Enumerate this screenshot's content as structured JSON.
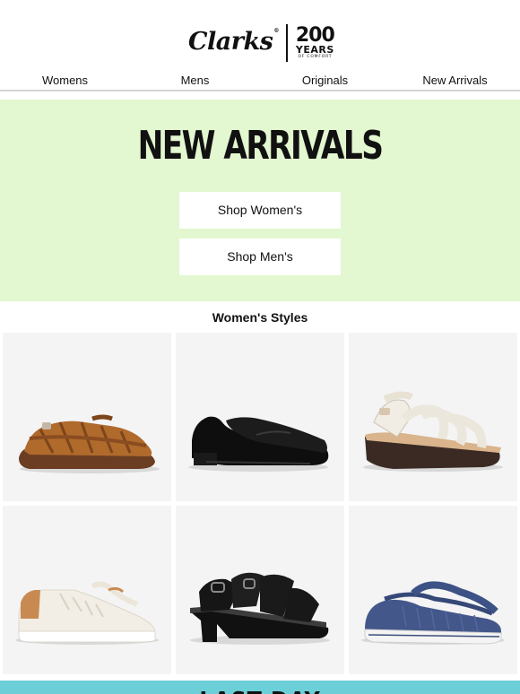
{
  "brand": {
    "wordmark": "Clarks",
    "reg_mark": "®",
    "anniversary_number": "200",
    "anniversary_word": "YEARS",
    "anniversary_tagline": "OF COMFORT"
  },
  "nav": {
    "items": [
      {
        "label": "Womens"
      },
      {
        "label": "Mens"
      },
      {
        "label": "Originals"
      },
      {
        "label": "New Arrivals"
      }
    ]
  },
  "hero": {
    "title": "NEW ARRIVALS",
    "background": "#e3f7d0",
    "buttons": {
      "women": "Shop Women's",
      "men": "Shop Men's"
    }
  },
  "section": {
    "title": "Women's Styles"
  },
  "products": [
    {
      "icon": "tan-fisherman-sandal-image"
    },
    {
      "icon": "black-leather-loafer-image"
    },
    {
      "icon": "white-strappy-wedge-sandal-image"
    },
    {
      "icon": "white-knit-sneaker-image"
    },
    {
      "icon": "black-buckle-heeled-sandal-image"
    },
    {
      "icon": "navy-knit-slip-on-image"
    }
  ],
  "banner": {
    "text": "LAST DAY",
    "background": "#6ccfd8"
  },
  "colors": {
    "tile_bg": "#f4f4f4",
    "nav_rule": "#d4d4d4"
  }
}
